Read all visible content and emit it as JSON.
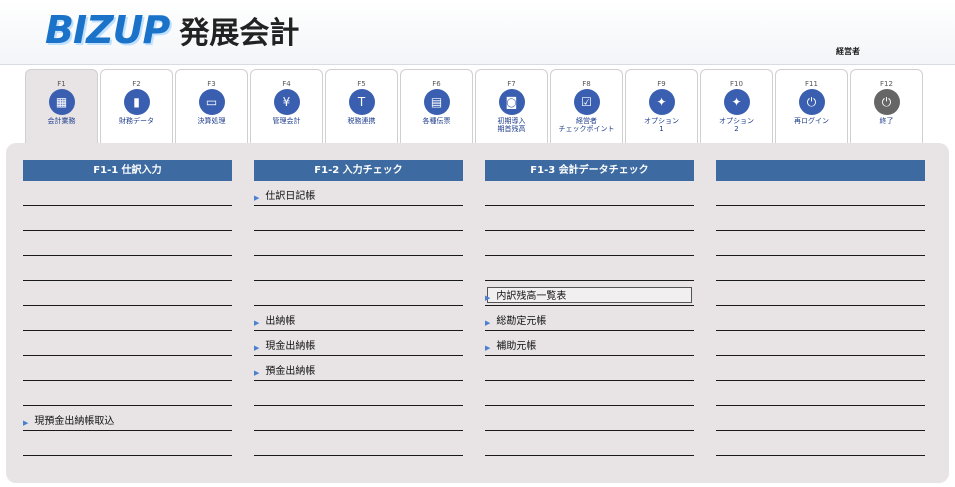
{
  "app": {
    "logo_text": "BIZUP",
    "name": "発展会計",
    "user": "経営者"
  },
  "tabs": [
    {
      "key": "F1",
      "label": "会計業務",
      "icon": "calculator-icon",
      "color": "#3a5fb0",
      "glyph": "▦",
      "active": true
    },
    {
      "key": "F2",
      "label": "財務データ",
      "icon": "bar-chart-icon",
      "color": "#3a5fb0",
      "glyph": "▮"
    },
    {
      "key": "F3",
      "label": "決算処理",
      "icon": "laptop-icon",
      "color": "#3a5fb0",
      "glyph": "▭"
    },
    {
      "key": "F4",
      "label": "管理会計",
      "icon": "yen-folder-icon",
      "color": "#3a5fb0",
      "glyph": "¥"
    },
    {
      "key": "F5",
      "label": "税務連携",
      "icon": "tax-icon",
      "color": "#3a5fb0",
      "glyph": "T"
    },
    {
      "key": "F6",
      "label": "各種伝票",
      "icon": "ledger-icon",
      "color": "#3a5fb0",
      "glyph": "▤"
    },
    {
      "key": "F7",
      "label": "初期導入\n期首残高",
      "icon": "safe-icon",
      "color": "#3a5fb0",
      "glyph": "◙"
    },
    {
      "key": "F8",
      "label": "経営者\nチェックポイント",
      "icon": "checkbox-icon",
      "color": "#3a5fb0",
      "glyph": "☑"
    },
    {
      "key": "F9",
      "label": "オプション\n1",
      "icon": "lightbulb-icon",
      "color": "#3a5fb0",
      "glyph": "✦"
    },
    {
      "key": "F10",
      "label": "オプション\n2",
      "icon": "lightbulb-icon",
      "color": "#3a5fb0",
      "glyph": "✦"
    },
    {
      "key": "F11",
      "label": "再ログイン",
      "icon": "power-icon",
      "color": "#3a5fb0",
      "glyph": "⏻"
    },
    {
      "key": "F12",
      "label": "終了",
      "icon": "power-icon",
      "color": "#666666",
      "glyph": "⏻"
    }
  ],
  "columns": [
    {
      "title": "F1-1 仕訳入力",
      "rows": [
        "",
        "",
        "",
        "",
        "",
        "",
        "",
        "",
        "",
        "",
        "",
        ""
      ],
      "items": {
        "9": "現預金出納帳取込"
      }
    },
    {
      "title": "F1-2 入力チェック",
      "rows": [],
      "items": {
        "0": "仕訳日記帳",
        "5": "出納帳",
        "6": "現金出納帳",
        "7": "預金出納帳"
      }
    },
    {
      "title": "F1-3 会計データチェック",
      "rows": [],
      "items": {
        "4": "内訳残高一覧表",
        "5": "総勘定元帳",
        "6": "補助元帳"
      },
      "selected": 4
    },
    {
      "title": "",
      "rows": [],
      "items": {}
    }
  ]
}
